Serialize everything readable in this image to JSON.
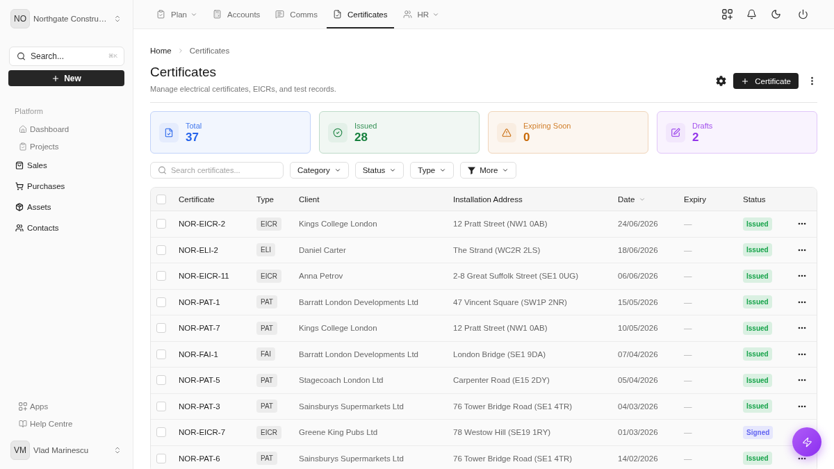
{
  "sidebar": {
    "workspace": {
      "initials": "NO",
      "name": "Northgate Constru…"
    },
    "search": {
      "placeholder": "Search...",
      "shortcut": "⌘K"
    },
    "new_button": "New",
    "section_label": "Platform",
    "items": [
      {
        "label": "Dashboard",
        "muted": true
      },
      {
        "label": "Projects",
        "muted": true
      },
      {
        "label": "Sales",
        "muted": false
      },
      {
        "label": "Purchases",
        "muted": false
      },
      {
        "label": "Assets",
        "muted": false
      },
      {
        "label": "Contacts",
        "muted": false
      }
    ],
    "footer_items": [
      {
        "label": "Apps"
      },
      {
        "label": "Help Centre"
      }
    ],
    "user": {
      "initials": "VM",
      "name": "Vlad Marinescu"
    }
  },
  "top_nav": {
    "tabs": [
      {
        "label": "Plan",
        "selected": false,
        "has_menu": true
      },
      {
        "label": "Accounts",
        "selected": false,
        "has_menu": false
      },
      {
        "label": "Comms",
        "selected": false,
        "has_menu": false
      },
      {
        "label": "Certificates",
        "selected": true,
        "has_menu": false
      },
      {
        "label": "HR",
        "selected": false,
        "has_menu": true
      }
    ]
  },
  "breadcrumb": [
    "Home",
    "Certificates"
  ],
  "page": {
    "title": "Certificates",
    "subtitle": "Manage electrical certificates, EICRs, and test records.",
    "primary_button": "Certificate"
  },
  "stats": [
    {
      "label": "Total",
      "value": "37",
      "color": "#2563eb"
    },
    {
      "label": "Issued",
      "value": "28",
      "color": "#16803d"
    },
    {
      "label": "Expiring Soon",
      "value": "0",
      "color": "#c96a08"
    },
    {
      "label": "Drafts",
      "value": "2",
      "color": "#9333ea"
    }
  ],
  "filters": {
    "search": {
      "placeholder": "Search certificates..."
    },
    "buttons": [
      {
        "label": "Category",
        "kind": "dropdown"
      },
      {
        "label": "Status",
        "kind": "dropdown"
      },
      {
        "label": "Type",
        "kind": "dropdown"
      },
      {
        "label": "More",
        "kind": "filter"
      }
    ]
  },
  "table": {
    "header_checkbox": {
      "checked": false
    },
    "columns": [
      {
        "label": "Certificate",
        "sorted": false
      },
      {
        "label": "Type",
        "sorted": false
      },
      {
        "label": "Client",
        "sorted": false
      },
      {
        "label": "Installation Address",
        "sorted": false
      },
      {
        "label": "Date",
        "sorted": true
      },
      {
        "label": "Expiry",
        "sorted": false
      },
      {
        "label": "Status",
        "sorted": false
      }
    ],
    "rows": [
      {
        "checked": false,
        "certificate": "NOR-EICR-2",
        "type": "EICR",
        "client": "Kings College London",
        "address": "12 Pratt Street (NW1 0AB)",
        "date": "24/06/2026",
        "expiry": "—",
        "status": {
          "label": "Issued",
          "color": "#16a34a"
        }
      },
      {
        "checked": false,
        "certificate": "NOR-ELI-2",
        "type": "ELI",
        "client": "Daniel Carter",
        "address": "The Strand (WC2R 2LS)",
        "date": "18/06/2026",
        "expiry": "—",
        "status": {
          "label": "Issued",
          "color": "#16a34a"
        }
      },
      {
        "checked": false,
        "certificate": "NOR-EICR-11",
        "type": "EICR",
        "client": "Anna Petrov",
        "address": "2-8 Great Suffolk Street (SE1 0UG)",
        "date": "06/06/2026",
        "expiry": "—",
        "status": {
          "label": "Issued",
          "color": "#16a34a"
        }
      },
      {
        "checked": false,
        "certificate": "NOR-PAT-1",
        "type": "PAT",
        "client": "Barratt London Developments Ltd",
        "address": "47 Vincent Square (SW1P 2NR)",
        "date": "15/05/2026",
        "expiry": "—",
        "status": {
          "label": "Issued",
          "color": "#16a34a"
        }
      },
      {
        "checked": false,
        "certificate": "NOR-PAT-7",
        "type": "PAT",
        "client": "Kings College London",
        "address": "12 Pratt Street (NW1 0AB)",
        "date": "10/05/2026",
        "expiry": "—",
        "status": {
          "label": "Issued",
          "color": "#16a34a"
        }
      },
      {
        "checked": false,
        "certificate": "NOR-FAI-1",
        "type": "FAI",
        "client": "Barratt London Developments Ltd",
        "address": "London Bridge (SE1 9DA)",
        "date": "07/04/2026",
        "expiry": "—",
        "status": {
          "label": "Issued",
          "color": "#16a34a"
        }
      },
      {
        "checked": false,
        "certificate": "NOR-PAT-5",
        "type": "PAT",
        "client": "Stagecoach London Ltd",
        "address": "Carpenter Road (E15 2DY)",
        "date": "05/04/2026",
        "expiry": "—",
        "status": {
          "label": "Issued",
          "color": "#16a34a"
        }
      },
      {
        "checked": false,
        "certificate": "NOR-PAT-3",
        "type": "PAT",
        "client": "Sainsburys Supermarkets Ltd",
        "address": "76 Tower Bridge Road (SE1 4TR)",
        "date": "04/03/2026",
        "expiry": "—",
        "status": {
          "label": "Issued",
          "color": "#16a34a"
        }
      },
      {
        "checked": false,
        "certificate": "NOR-EICR-7",
        "type": "EICR",
        "client": "Greene King Pubs Ltd",
        "address": "78 Westow Hill (SE19 1RY)",
        "date": "01/03/2026",
        "expiry": "—",
        "status": {
          "label": "Signed",
          "color": "#6366f1"
        }
      },
      {
        "checked": false,
        "certificate": "NOR-PAT-6",
        "type": "PAT",
        "client": "Sainsburys Supermarkets Ltd",
        "address": "76 Tower Bridge Road (SE1 4TR)",
        "date": "14/02/2026",
        "expiry": "—",
        "status": {
          "label": "Issued",
          "color": "#16a34a"
        }
      }
    ]
  }
}
